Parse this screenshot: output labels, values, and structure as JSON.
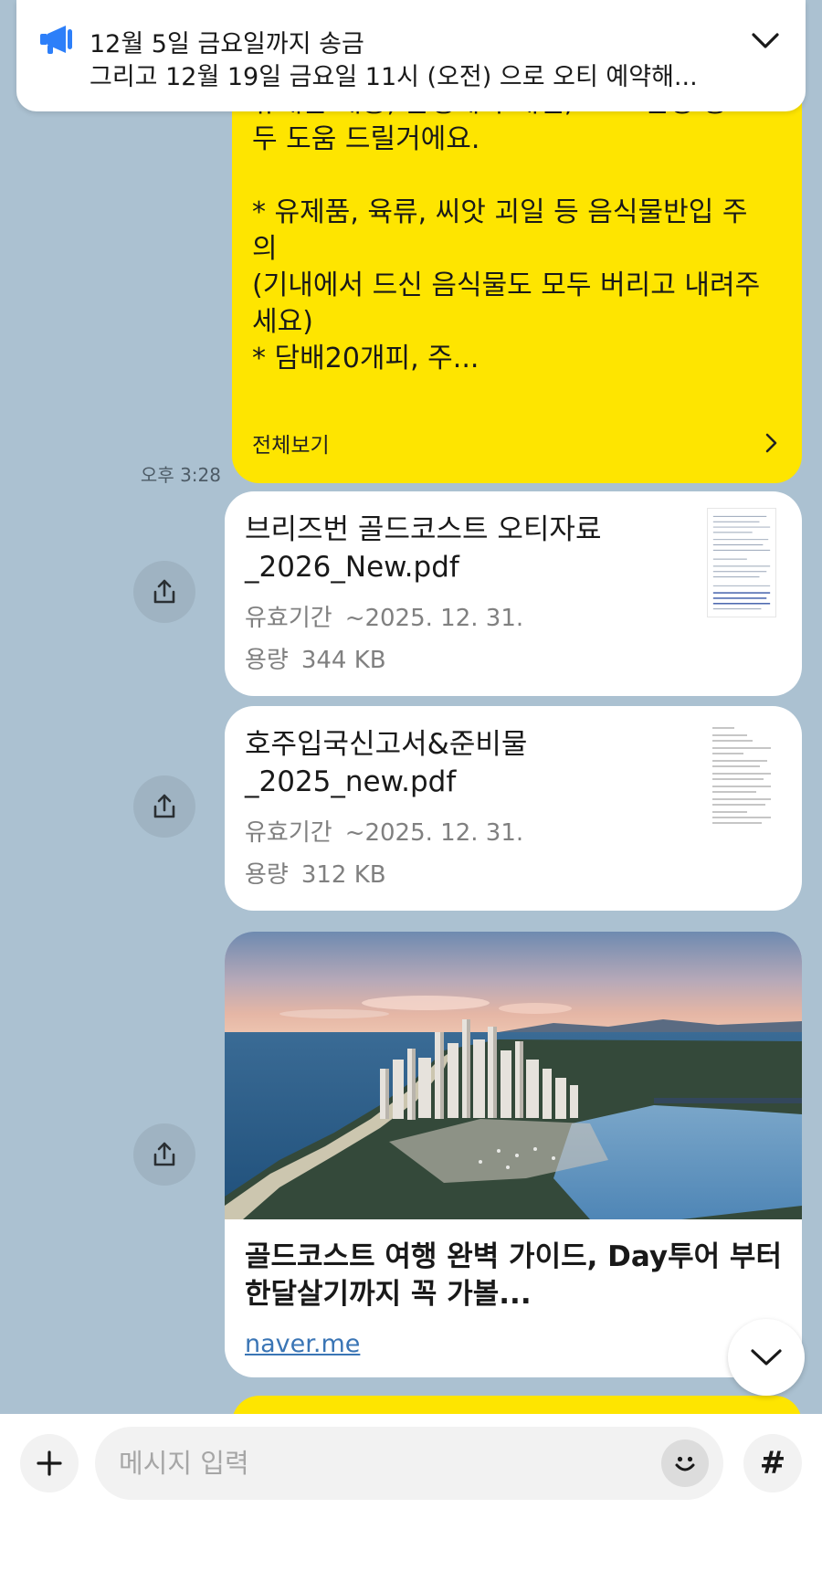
{
  "notice": {
    "title": "12월 5일 금요일까지 송금",
    "subtitle": "그리고 12월 19일 금요일 11시 (오전) 으로 오티 예약해..."
  },
  "messages": {
    "yellow_text": "휴대폰 개통, 은행계좌 개설, TFN 신청 등 모\n두 도움 드릴거에요.\n\n* 유제품, 육류, 씨앗 괴일 등 음식물반입 주\n의\n(기내에서 드신 음식물도 모두 버리고 내려주\n세요)\n* 담배20개피, 주...",
    "see_all_label": "전체보기",
    "timestamp": "오후 3:28"
  },
  "files": [
    {
      "name": "브리즈번 골드코스트 오티자료\n_2026_New.pdf",
      "expiry_label": "유효기간",
      "expiry_value": "~2025. 12. 31.",
      "size_label": "용량",
      "size_value": "344 KB"
    },
    {
      "name": "호주입국신고서&준비물\n_2025_new.pdf",
      "expiry_label": "유효기간",
      "expiry_value": "~2025. 12. 31.",
      "size_label": "용량",
      "size_value": "312 KB"
    }
  ],
  "link": {
    "title": "골드코스트 여행 완벽 가이드, Day투어 부터\n한달살기까지 꼭 가볼...",
    "domain": "naver.me"
  },
  "input": {
    "placeholder": "메시지 입력",
    "hash_label": "#"
  },
  "icons": {
    "notice": "megaphone-icon",
    "expand": "chevron-down-icon",
    "see_all": "chevron-right-icon",
    "share": "share-icon",
    "plus": "plus-icon",
    "emoji": "emoji-icon"
  },
  "colors": {
    "chat_background": "#abc1d1",
    "my_bubble": "#fee500",
    "card": "#ffffff",
    "notice_icon": "#2d7ff9",
    "link": "#3a75b5"
  }
}
